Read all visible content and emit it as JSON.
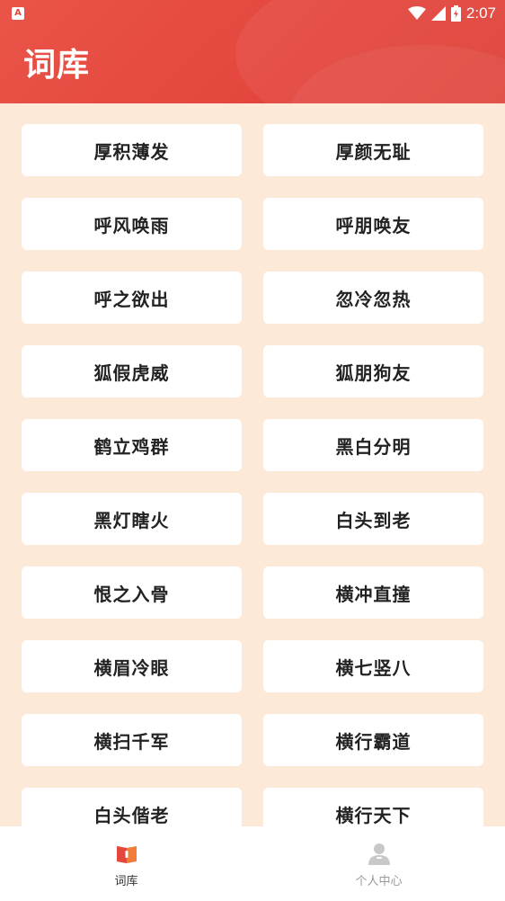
{
  "status_bar": {
    "left_badge": "A",
    "time": "2:07"
  },
  "header": {
    "title": "词库"
  },
  "words": [
    "厚积薄发",
    "厚颜无耻",
    "呼风唤雨",
    "呼朋唤友",
    "呼之欲出",
    "忽冷忽热",
    "狐假虎威",
    "狐朋狗友",
    "鹤立鸡群",
    "黑白分明",
    "黑灯瞎火",
    "白头到老",
    "恨之入骨",
    "横冲直撞",
    "横眉冷眼",
    "横七竖八",
    "横扫千军",
    "横行霸道",
    "白头偕老",
    "横行天下"
  ],
  "bottom_nav": {
    "items": [
      {
        "label": "词库",
        "icon": "book-icon",
        "active": true
      },
      {
        "label": "个人中心",
        "icon": "user-icon",
        "active": false
      }
    ]
  },
  "colors": {
    "header": "#e4473e",
    "background": "#fde9d8",
    "card": "#ffffff",
    "text": "#222222"
  }
}
